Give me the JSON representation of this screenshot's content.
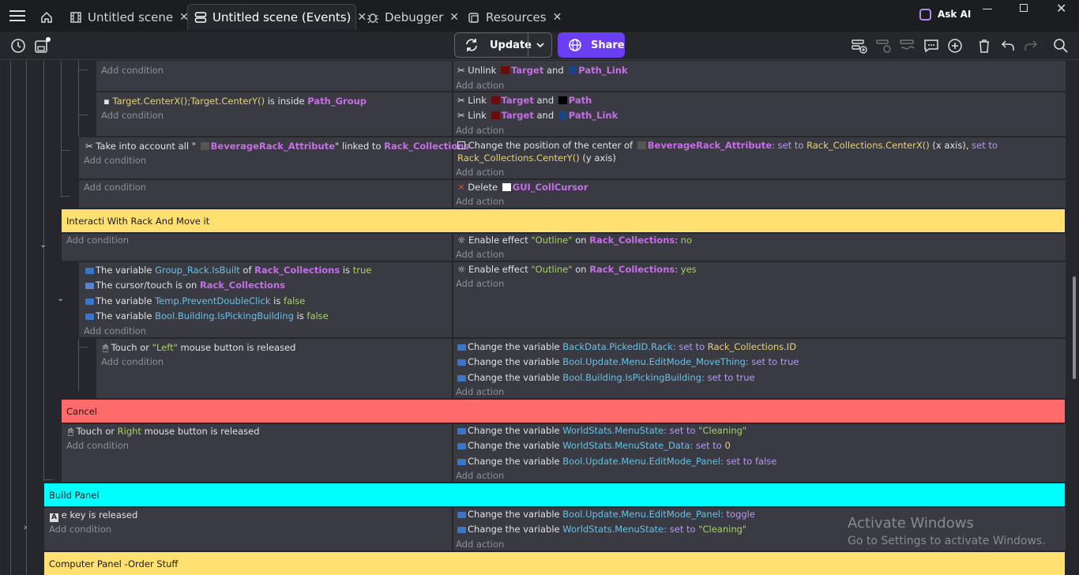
{
  "tabs": [
    {
      "label": "Untitled scene",
      "icon": "film-icon",
      "active": false
    },
    {
      "label": "Untitled scene (Events)",
      "icon": "events-icon",
      "active": true
    },
    {
      "label": "Debugger",
      "icon": "bug-icon",
      "active": false
    },
    {
      "label": "Resources",
      "icon": "resources-icon",
      "active": false
    }
  ],
  "close_glyph": "✕",
  "ask_ai": "Ask AI",
  "toolbar": {
    "update": "Update",
    "share": "Share"
  },
  "events": {
    "r1_cond_add": "Add condition",
    "r1_act_unlink": "Unlink",
    "r1_act_target": "Target",
    "r1_act_and": "and",
    "r1_act_pathlink": "Path_Link",
    "r1_act_add": "Add action",
    "r2_cond_a": "Target.CenterX();Target.CenterY()",
    "r2_cond_b": " is inside ",
    "r2_cond_c": "Path_Group",
    "r2_cond_add": "Add condition",
    "r2_act1_link": "Link",
    "r2_act1_target": "Target",
    "r2_act1_and": "and",
    "r2_act1_path": "Path",
    "r2_act2_link": "Link",
    "r2_act2_target": "Target",
    "r2_act2_and": "and",
    "r2_act2_pathlink": "Path_Link",
    "r2_act_add": "Add action",
    "r3_cond_a": "Take into account all \"",
    "r3_cond_obj": "BeverageRack_Attribute",
    "r3_cond_b": "\" linked to ",
    "r3_cond_c": "Rack_Collections",
    "r3_cond_add": "Add condition",
    "r3_act_a": "Change the position of the center of ",
    "r3_act_obj": "BeverageRack_Attribute",
    "r3_act_b": ": set to ",
    "r3_act_c": "Rack_Collections.CenterX()",
    "r3_act_d": " (x axis), ",
    "r3_act_e": "set to",
    "r3_act_f": "Rack_Collections.CenterY()",
    "r3_act_g": " (y axis)",
    "r3_act_add": "Add action",
    "r4_cond_add": "Add condition",
    "r4_act_a": "Delete ",
    "r4_act_obj": "GUI_CollCursor",
    "r4_act_add": "Add action",
    "g1": "Interacti With Rack And Move it",
    "r5_cond_add": "Add condition",
    "r5_act_a": "Enable effect ",
    "r5_act_eff": "\"Outline\"",
    "r5_act_on": " on ",
    "r5_act_obj": "Rack_Collections",
    "r5_act_colon": ": ",
    "r5_act_val": "no",
    "r5_act_add": "Add action",
    "r6_c1_a": "The variable ",
    "r6_c1_var": "Group_Rack.IsBuilt",
    "r6_c1_of": " of ",
    "r6_c1_obj": "Rack_Collections",
    "r6_c1_is": " is ",
    "r6_c1_val": "true",
    "r6_c2_a": "The cursor/touch is on ",
    "r6_c2_obj": "Rack_Collections",
    "r6_c3_a": "The variable ",
    "r6_c3_var": "Temp.PreventDoubleClick",
    "r6_c3_is": " is ",
    "r6_c3_val": "false",
    "r6_c4_a": "The variable ",
    "r6_c4_var": "Bool.Building.IsPickingBuilding",
    "r6_c4_is": " is ",
    "r6_c4_val": "false",
    "r6_cond_add": "Add condition",
    "r6_act_a": "Enable effect ",
    "r6_act_eff": "\"Outline\"",
    "r6_act_on": " on ",
    "r6_act_obj": "Rack_Collections",
    "r6_act_colon": ": ",
    "r6_act_val": "yes",
    "r6_act_add": "Add action",
    "r7_cond_a": "Touch or ",
    "r7_cond_btn": "\"Left\"",
    "r7_cond_b": " mouse button is released",
    "r7_cond_add": "Add condition",
    "r7_a1_a": "Change the variable ",
    "r7_a1_var": "BackData.PickedID.Rack",
    "r7_a1_set": ": set to ",
    "r7_a1_val": "Rack_Collections.ID",
    "r7_a2_a": "Change the variable ",
    "r7_a2_var": "Bool.Update.Menu.EditMode_MoveThing",
    "r7_a2_set": ": set to true",
    "r7_a3_a": "Change the variable ",
    "r7_a3_var": "Bool.Building.IsPickingBuilding",
    "r7_a3_set": ": set to true",
    "r7_act_add": "Add action",
    "g2": "Cancel",
    "r8_cond_a": "Touch or ",
    "r8_cond_btn": "Right",
    "r8_cond_b": " mouse button is released",
    "r8_cond_add": "Add condition",
    "r8_a1_a": "Change the variable ",
    "r8_a1_var": "WorldStats.MenuState",
    "r8_a1_set": ": set to ",
    "r8_a1_val": "\"Cleaning\"",
    "r8_a2_a": "Change the variable ",
    "r8_a2_var": "WorldStats.MenuState_Data",
    "r8_a2_set": ": set to ",
    "r8_a2_val": "0",
    "r8_a3_a": "Change the variable ",
    "r8_a3_var": "Bool.Update.Menu.EditMode_Panel",
    "r8_a3_set": ": set to false",
    "r8_act_add": "Add action",
    "g3": "Build Panel",
    "r9_cond_a": "e key is released",
    "r9_cond_add": "Add condition",
    "r9_a1_a": "Change the variable ",
    "r9_a1_var": "Bool.Update.Menu.EditMode_Panel",
    "r9_a1_set": ": toggle",
    "r9_a2_a": "Change the variable ",
    "r9_a2_var": "WorldStats.MenuState",
    "r9_a2_set": ": set to ",
    "r9_a2_val": "\"Cleaning\"",
    "r9_act_add": "Add action",
    "g4": "Computer Panel -Order Stuff"
  },
  "watermark": {
    "line1": "Activate Windows",
    "line2": "Go to Settings to activate Windows."
  },
  "colors": {
    "group_yellow": "#ffe070",
    "group_red": "#ff6b6b",
    "group_cyan": "#00ffff",
    "share_purple": "#6b3ef2",
    "object_purple": "#c56fe6",
    "variable_blue": "#69c0e6",
    "value_green": "#a8d26a"
  }
}
